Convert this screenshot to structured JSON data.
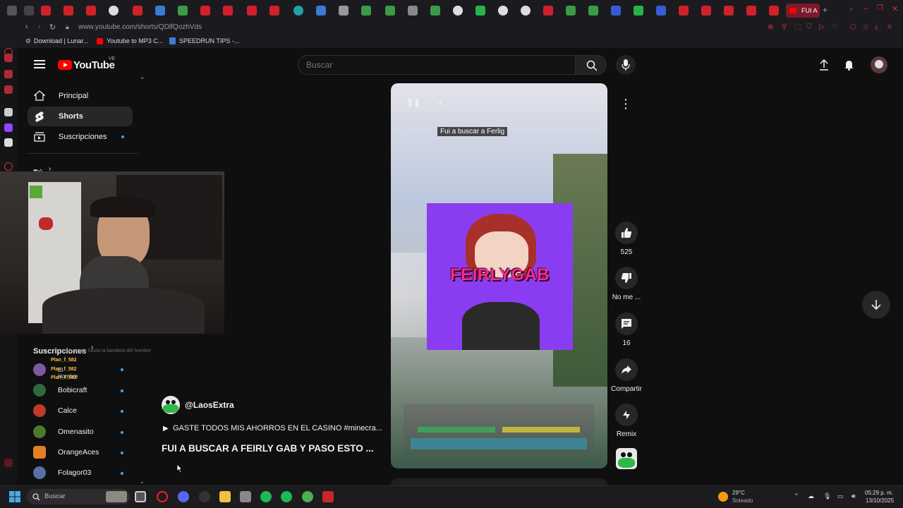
{
  "browser": {
    "url": "www.youtube.com/shorts/QDlfQozhVds",
    "active_tab_title": "FUI A",
    "bookmarks": [
      "Download | Lunar...",
      "Youtube to MP3 C...",
      "SPEEDRUN TIPS -..."
    ]
  },
  "header": {
    "logo_text": "YouTube",
    "country_code": "VE",
    "search_placeholder": "Buscar"
  },
  "sidebar": {
    "items": [
      {
        "label": "Principal",
        "icon": "home-icon"
      },
      {
        "label": "Shorts",
        "icon": "shorts-icon"
      },
      {
        "label": "Suscripciones",
        "icon": "subscriptions-icon"
      }
    ],
    "you_label": "Tú",
    "subscriptions_title": "Suscripciones",
    "subscriptions": [
      {
        "name": "Bobicraft",
        "color": "#2f6b3a"
      },
      {
        "name": "Calce",
        "color": "#c0392b"
      },
      {
        "name": "Omenasito",
        "color": "#4a7a2a"
      },
      {
        "name": "OrangeAces",
        "color": "#e67e22"
      },
      {
        "name": "Folagor03",
        "color": "#5a6fa8"
      }
    ],
    "first_sub_name": "El Hombre"
  },
  "chat_overlay": {
    "line1": "Plan_f_582",
    "line2": "Plan_f_582",
    "line3": "Plan_f_582",
    "faded": "ya le vimos hasta la bandera del hombre"
  },
  "short": {
    "caption": "Fui a buscar a Ferlig",
    "thumbnail_text": "FEIRLYGAB",
    "channel": "@LaosExtra",
    "playlist_text": "GASTE TODOS MIS AHORROS EN EL CASINO #minecra...",
    "title": "FUI A BUSCAR A FEIRLY GAB Y PASO ESTO  ...",
    "likes": "525",
    "dislike_label": "No me ...",
    "comments": "16",
    "share_label": "Compartir",
    "remix_label": "Remix"
  },
  "taskbar": {
    "search_placeholder": "Buscar",
    "weather_temp": "29°C",
    "weather_desc": "Soleado",
    "time": "05:29 p. m.",
    "date": "13/10/2025"
  },
  "colors": {
    "brand_red": "#ff0000",
    "accent_blue": "#3ea6ff",
    "thumbnail_purple": "#8a3df0",
    "thumbnail_text": "#ff2a8a"
  }
}
